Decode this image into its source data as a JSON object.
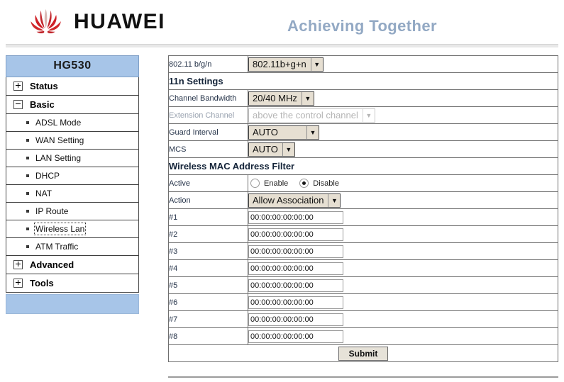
{
  "header": {
    "brand": "HUAWEI",
    "tagline": "Achieving Together",
    "logo_icon": "huawei-flower-logo"
  },
  "sidebar": {
    "title": "HG530",
    "groups": [
      {
        "label": "Status",
        "expanded": false,
        "icon": "plus-box-icon",
        "children": []
      },
      {
        "label": "Basic",
        "expanded": true,
        "icon": "minus-box-icon",
        "children": [
          {
            "label": "ADSL Mode",
            "active": false
          },
          {
            "label": "WAN Setting",
            "active": false
          },
          {
            "label": "LAN Setting",
            "active": false
          },
          {
            "label": "DHCP",
            "active": false
          },
          {
            "label": "NAT",
            "active": false
          },
          {
            "label": "IP Route",
            "active": false
          },
          {
            "label": "Wireless Lan",
            "active": true
          },
          {
            "label": "ATM Traffic",
            "active": false
          }
        ]
      },
      {
        "label": "Advanced",
        "expanded": false,
        "icon": "plus-box-icon",
        "children": []
      },
      {
        "label": "Tools",
        "expanded": false,
        "icon": "plus-box-icon",
        "children": []
      }
    ]
  },
  "main": {
    "mode_row": {
      "label": "802.11 b/g/n",
      "value": "802.11b+g+n"
    },
    "section_11n": "11n Settings",
    "channel_bandwidth": {
      "label": "Channel Bandwidth",
      "value": "20/40 MHz"
    },
    "extension_channel": {
      "label": "Extension Channel",
      "value": "above the control channel",
      "disabled": true
    },
    "guard_interval": {
      "label": "Guard Interval",
      "value": "AUTO"
    },
    "mcs": {
      "label": "MCS",
      "value": "AUTO"
    },
    "section_mac": "Wireless MAC Address Filter",
    "active": {
      "label": "Active",
      "enable_label": "Enable",
      "disable_label": "Disable",
      "selected": "Disable"
    },
    "action": {
      "label": "Action",
      "value": "Allow Association"
    },
    "mac_entries": [
      {
        "label": "#1",
        "value": "00:00:00:00:00:00"
      },
      {
        "label": "#2",
        "value": "00:00:00:00:00:00"
      },
      {
        "label": "#3",
        "value": "00:00:00:00:00:00"
      },
      {
        "label": "#4",
        "value": "00:00:00:00:00:00"
      },
      {
        "label": "#5",
        "value": "00:00:00:00:00:00"
      },
      {
        "label": "#6",
        "value": "00:00:00:00:00:00"
      },
      {
        "label": "#7",
        "value": "00:00:00:00:00:00"
      },
      {
        "label": "#8",
        "value": "00:00:00:00:00:00"
      }
    ],
    "submit_label": "Submit"
  },
  "colors": {
    "accent_blue": "#9dbde3",
    "sidebar_title": "#a7c5e8",
    "tagline": "#93a9c4",
    "logo_red": "#cf2027"
  }
}
